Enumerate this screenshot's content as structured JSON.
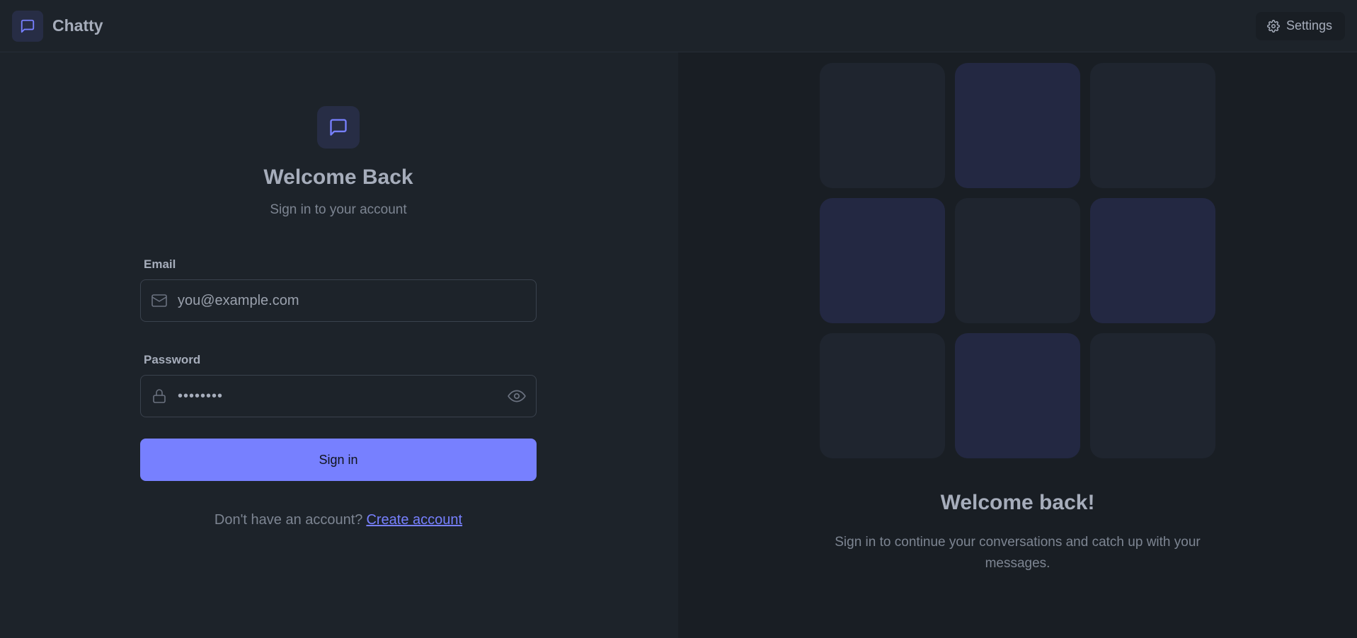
{
  "header": {
    "app_name": "Chatty",
    "brand_icon": "message-square-icon",
    "settings_label": "Settings",
    "settings_icon": "gear-icon"
  },
  "login": {
    "logo_icon": "message-square-icon",
    "title": "Welcome Back",
    "subtitle": "Sign in to your account",
    "email": {
      "label": "Email",
      "placeholder": "you@example.com",
      "value": "",
      "icon": "mail-icon"
    },
    "password": {
      "label": "Password",
      "value": "••••••••",
      "icon": "lock-icon",
      "toggle_icon": "eye-icon"
    },
    "submit_label": "Sign in",
    "signup_prompt": "Don't have an account?",
    "signup_link": "Create account"
  },
  "promo": {
    "tiles": [
      "plain",
      "accent",
      "plain",
      "accent",
      "plain",
      "accent",
      "plain",
      "accent",
      "plain"
    ],
    "title": "Welcome back!",
    "text": "Sign in to continue your conversations and catch up with your messages."
  },
  "colors": {
    "accent": "#7780ff",
    "background": "#1d232a",
    "panel": "#191e24",
    "tile_plain": "#1f252f",
    "tile_accent": "#232842"
  }
}
